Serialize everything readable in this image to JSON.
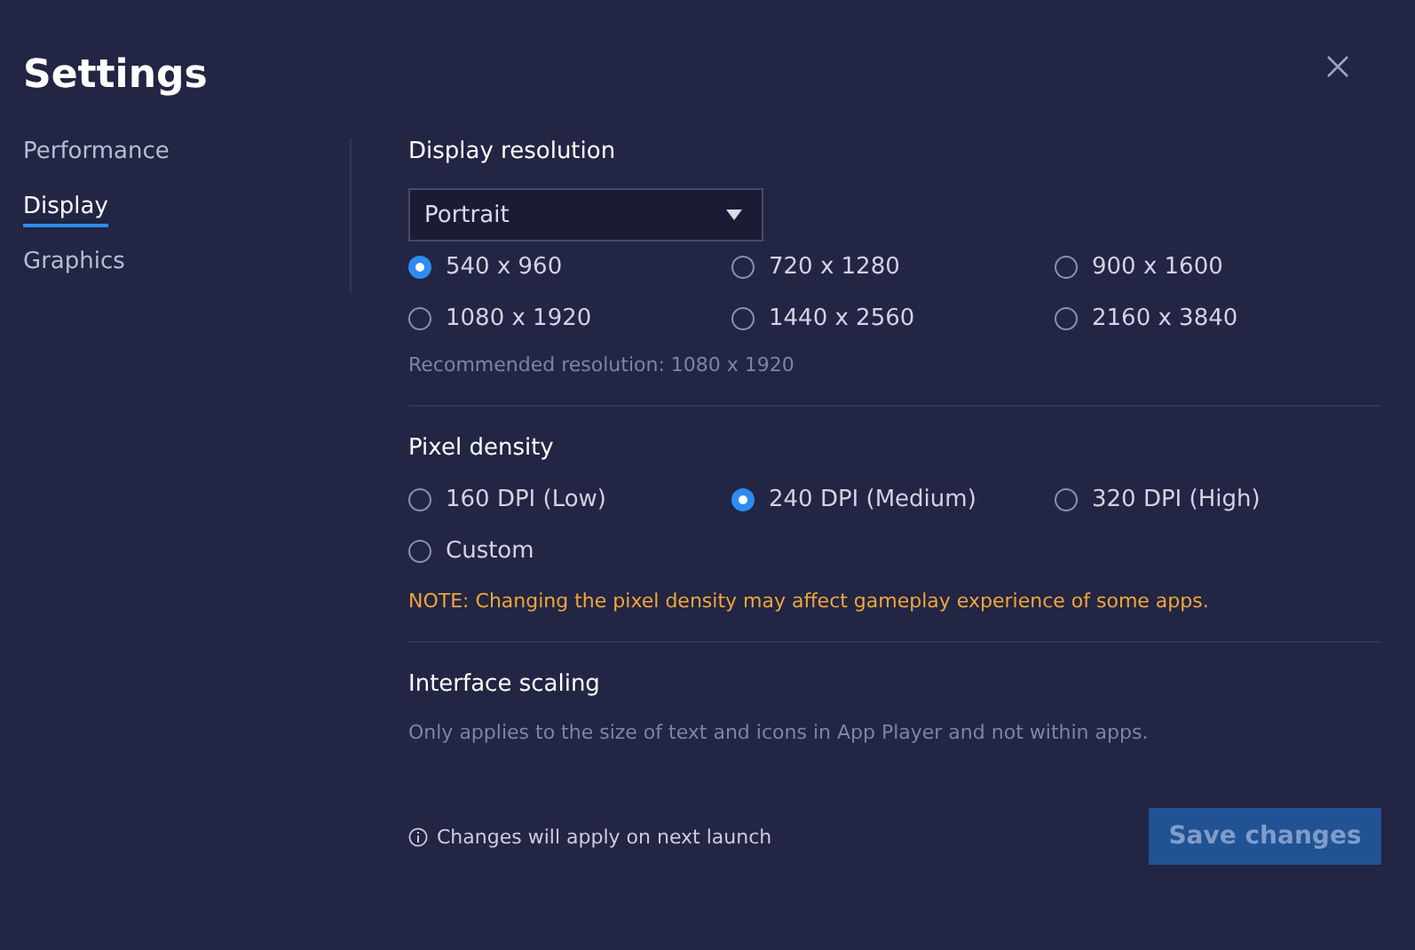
{
  "window": {
    "title": "Settings"
  },
  "sidebar": {
    "items": [
      {
        "label": "Performance",
        "selected": false
      },
      {
        "label": "Display",
        "selected": true
      },
      {
        "label": "Graphics",
        "selected": false
      }
    ]
  },
  "display_resolution": {
    "heading": "Display resolution",
    "orientation": {
      "value": "Portrait"
    },
    "options": [
      {
        "label": "540 x 960",
        "selected": true
      },
      {
        "label": "720 x 1280",
        "selected": false
      },
      {
        "label": "900 x 1600",
        "selected": false
      },
      {
        "label": "1080 x 1920",
        "selected": false
      },
      {
        "label": "1440 x 2560",
        "selected": false
      },
      {
        "label": "2160 x 3840",
        "selected": false
      }
    ],
    "hint": "Recommended resolution: 1080 x 1920"
  },
  "pixel_density": {
    "heading": "Pixel density",
    "options": [
      {
        "label": "160 DPI (Low)",
        "selected": false
      },
      {
        "label": "240 DPI (Medium)",
        "selected": true
      },
      {
        "label": "320 DPI (High)",
        "selected": false
      },
      {
        "label": "Custom",
        "selected": false
      }
    ],
    "note": "NOTE: Changing the pixel density may affect gameplay experience of some apps."
  },
  "interface_scaling": {
    "heading": "Interface scaling",
    "description": "Only applies to the size of text and icons in App Player and not within apps."
  },
  "footer": {
    "info": "Changes will apply on next launch",
    "save_button": {
      "label": "Save changes",
      "disabled": true
    }
  }
}
